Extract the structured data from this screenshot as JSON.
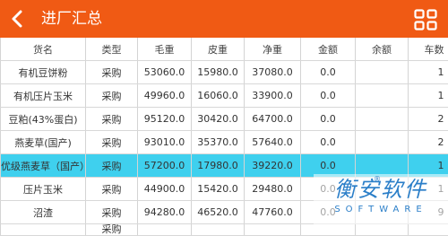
{
  "header": {
    "title": "进厂汇总",
    "back_icon": "back-arrow-icon",
    "menu_icon": "grid-menu-icon",
    "color": "#f05a14"
  },
  "table": {
    "columns": [
      "货名",
      "类型",
      "毛重",
      "皮重",
      "净重",
      "金额",
      "余额",
      "车数"
    ],
    "rows": [
      {
        "name": "有机豆饼粉",
        "type": "采购",
        "gross": "53060.0",
        "tare": "15980.0",
        "net": "37080.0",
        "amount": "0.0",
        "balance": "",
        "count": "1"
      },
      {
        "name": "有机压片玉米",
        "type": "采购",
        "gross": "49960.0",
        "tare": "16060.0",
        "net": "33900.0",
        "amount": "0.0",
        "balance": "",
        "count": "1"
      },
      {
        "name": "豆粕(43%蛋白)",
        "type": "采购",
        "gross": "95120.0",
        "tare": "30420.0",
        "net": "64700.0",
        "amount": "0.0",
        "balance": "",
        "count": "2"
      },
      {
        "name": "燕麦草(国产)",
        "type": "采购",
        "gross": "93010.0",
        "tare": "35370.0",
        "net": "57640.0",
        "amount": "0.0",
        "balance": "",
        "count": "2"
      },
      {
        "name": "优级燕麦草（国产）",
        "type": "采购",
        "gross": "57200.0",
        "tare": "17980.0",
        "net": "39220.0",
        "amount": "0.0",
        "balance": "",
        "count": "1"
      },
      {
        "name": "压片玉米",
        "type": "采购",
        "gross": "44900.0",
        "tare": "15420.0",
        "net": "29480.0",
        "amount": "0.0",
        "balance": "",
        "count": "1"
      },
      {
        "name": "沼渣",
        "type": "采购",
        "gross": "94280.0",
        "tare": "46520.0",
        "net": "47760.0",
        "amount": "0.0",
        "balance": "",
        "count": "9"
      },
      {
        "name": "",
        "type": "采购",
        "gross": "",
        "tare": "",
        "net": "",
        "amount": "",
        "balance": "",
        "count": ""
      }
    ],
    "selected_row": 4,
    "selected_color": "#3fd0ee"
  },
  "watermark": {
    "main": "衡安软件",
    "sub": "SOFTWARE",
    "reg": "®"
  }
}
